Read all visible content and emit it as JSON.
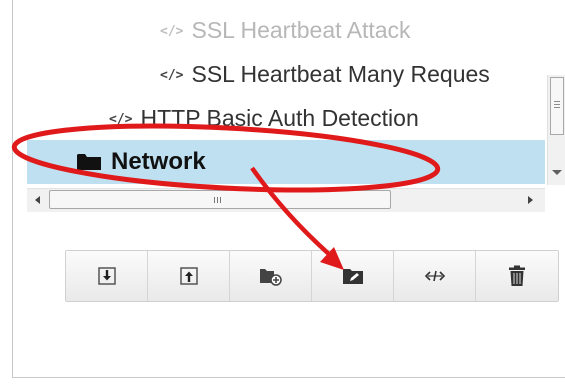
{
  "tree": {
    "items": [
      {
        "label": "SSL Heartbeat Attack",
        "state": "faded"
      },
      {
        "label": "SSL Heartbeat Many Reques",
        "state": "normal"
      },
      {
        "label": "HTTP Basic Auth Detection",
        "state": "normal"
      },
      {
        "label": "Network",
        "state": "selected"
      }
    ],
    "code_glyph": "</>"
  },
  "toolbar": {
    "buttons": [
      {
        "icon": "import-icon"
      },
      {
        "icon": "export-icon"
      },
      {
        "icon": "add-folder-icon"
      },
      {
        "icon": "edit-folder-icon"
      },
      {
        "icon": "code-move-icon"
      },
      {
        "icon": "trash-icon"
      }
    ]
  },
  "annotation": {
    "color": "#e01a1a"
  },
  "colors": {
    "selection": "#bfe0f0",
    "annotation": "#e01a1a"
  }
}
